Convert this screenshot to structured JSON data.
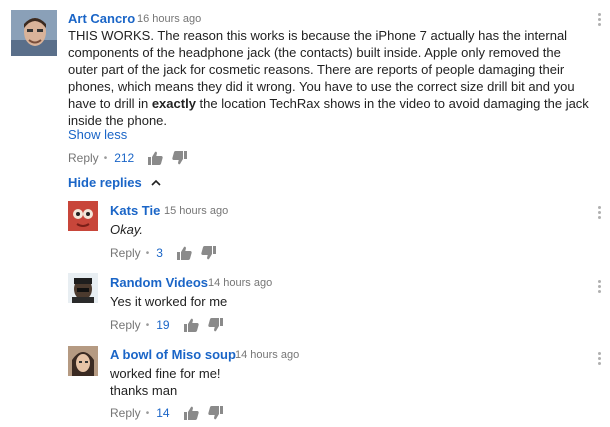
{
  "main_comment": {
    "author": "Art Cancro",
    "time": "16 hours ago",
    "text_line1": "THIS WORKS.  The reason this works is because the iPhone 7 actually has the internal",
    "text_line2": "components of the headphone jack (the contacts) built inside.  Apple only removed the",
    "text_line3": "outer part of the jack for cosmetic reasons.  There are reports of people damaging their",
    "text_line4": "phones, which means they did it wrong.  You have to use the correct size drill bit and you",
    "text_line5_pre": "have to drill in ",
    "text_line5_bold": "exactly",
    "text_line5_post": " the location TechRax shows in the video to avoid damaging the jack",
    "text_line6": "inside the phone.",
    "show_less": "Show less",
    "reply": "Reply",
    "likes": "212"
  },
  "hide_replies": "Hide replies",
  "replies": [
    {
      "author": "Kats Tie",
      "time": "15 hours ago",
      "text": "Okay.",
      "reply": "Reply",
      "likes": "3"
    },
    {
      "author": "Random Videos",
      "time": "14 hours ago",
      "text": "Yes it worked for me",
      "reply": "Reply",
      "likes": "19"
    },
    {
      "author": "A bowl of Miso soup",
      "time": "14 hours ago",
      "text_line1": "worked fine for me!",
      "text_line2": "thanks man",
      "reply": "Reply",
      "likes": "14"
    }
  ],
  "separator": "•",
  "icons": {
    "like": "thumbs-up-icon",
    "dislike": "thumbs-down-icon",
    "menu": "more-vertical-icon",
    "chevron": "chevron-up-icon"
  },
  "colors": {
    "link": "#1a65c7",
    "meta": "#767676",
    "text": "#222222",
    "icon": "#8a8a8a"
  }
}
